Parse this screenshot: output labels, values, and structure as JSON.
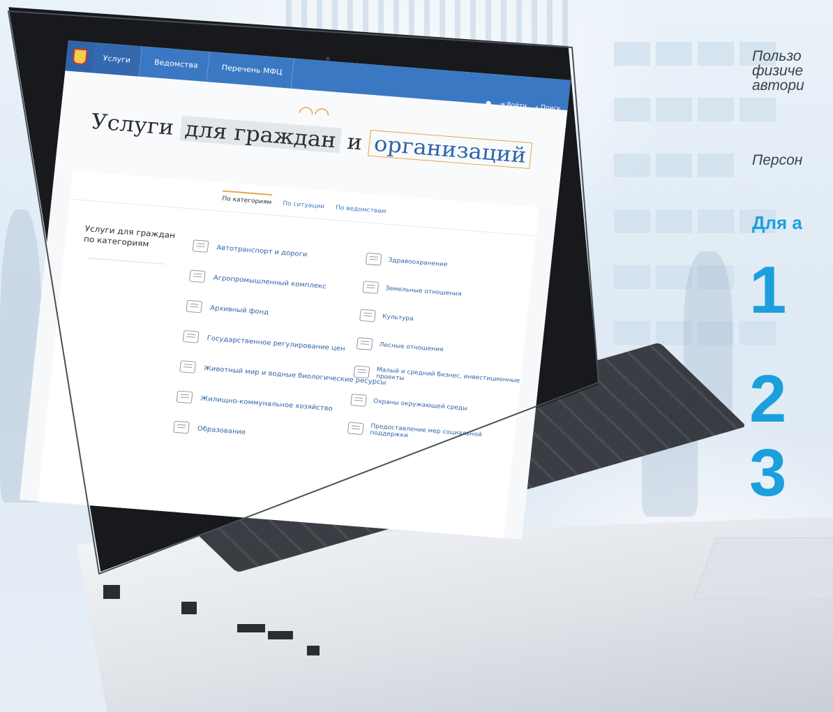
{
  "side_text": {
    "lead_line1": "Пользо",
    "lead_line2": "физиче",
    "lead_line3": "автори",
    "personal": "Персон",
    "for_heading": "Для а",
    "step_numbers": [
      "1",
      "2",
      "3"
    ]
  },
  "site": {
    "nav": [
      "Услуги",
      "Ведомства",
      "Перечень МФЦ"
    ],
    "top_right": {
      "login": "Войти",
      "search": "Поиск"
    },
    "hero": {
      "word1": "Услуги",
      "chip1": "для граждан",
      "word2": "и",
      "chip2": "организаций"
    },
    "tabs": [
      "По категориям",
      "По ситуации",
      "По ведомствам"
    ],
    "category_title": "Услуги для граждан по категориям",
    "categories_left": [
      "Автотранспорт и дороги",
      "Агропромышленный комплекс",
      "Архивный фонд",
      "Государственное регулирование цен",
      "Животный мир и водные биологические ресурсы",
      "Жилищно-коммунальное хозяйство",
      "Образование"
    ],
    "categories_right": [
      "Здравоохранение",
      "Земельные отношения",
      "Культура",
      "Лесные отношения",
      "Малый и средний бизнес, инвестиционные проекты",
      "Охраны окружающей среды",
      "Предоставление мер социальной поддержки"
    ]
  },
  "colors": {
    "accent": "#1c9fdc",
    "nav_blue": "#3b78c3",
    "highlight": "#e3a347"
  }
}
